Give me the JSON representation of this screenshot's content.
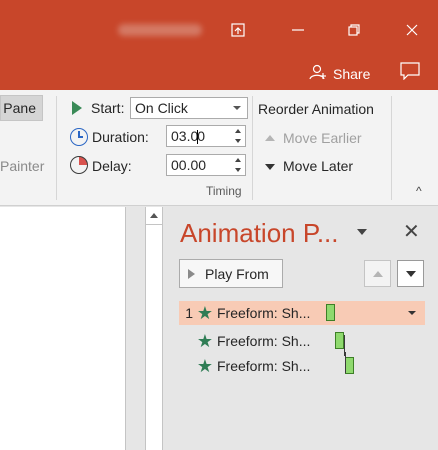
{
  "titlebar": {
    "ribbon_display_icon": "ribbon-display-options-icon",
    "minimize_icon": "minimize-icon",
    "restore_icon": "restore-icon",
    "close_icon": "close-icon",
    "share_label": "Share",
    "share_icon": "person-add-icon",
    "comment_icon": "comment-icon"
  },
  "ribbon": {
    "pane_label": "Pane",
    "painter_label": "Painter",
    "start_label": "Start:",
    "start_value": "On Click",
    "duration_label": "Duration:",
    "duration_value": "03.00",
    "delay_label": "Delay:",
    "delay_value": "00.00",
    "reorder_label": "Reorder Animation",
    "move_earlier_label": "Move Earlier",
    "move_later_label": "Move Later",
    "group_label": "Timing",
    "collapse_icon": "chevron-up-icon"
  },
  "animation_pane": {
    "title": "Animation P...",
    "play_from_label": "Play From",
    "items": [
      {
        "number": "1",
        "name": "Freeform: Sh..."
      },
      {
        "number": "",
        "name": "Freeform: Sh..."
      },
      {
        "number": "",
        "name": "Freeform: Sh..."
      }
    ]
  },
  "colors": {
    "accent": "#c8462a",
    "selected_row": "#f8cbb5",
    "star": "#2f7d55",
    "timeline_bar": "#8fd96e"
  }
}
